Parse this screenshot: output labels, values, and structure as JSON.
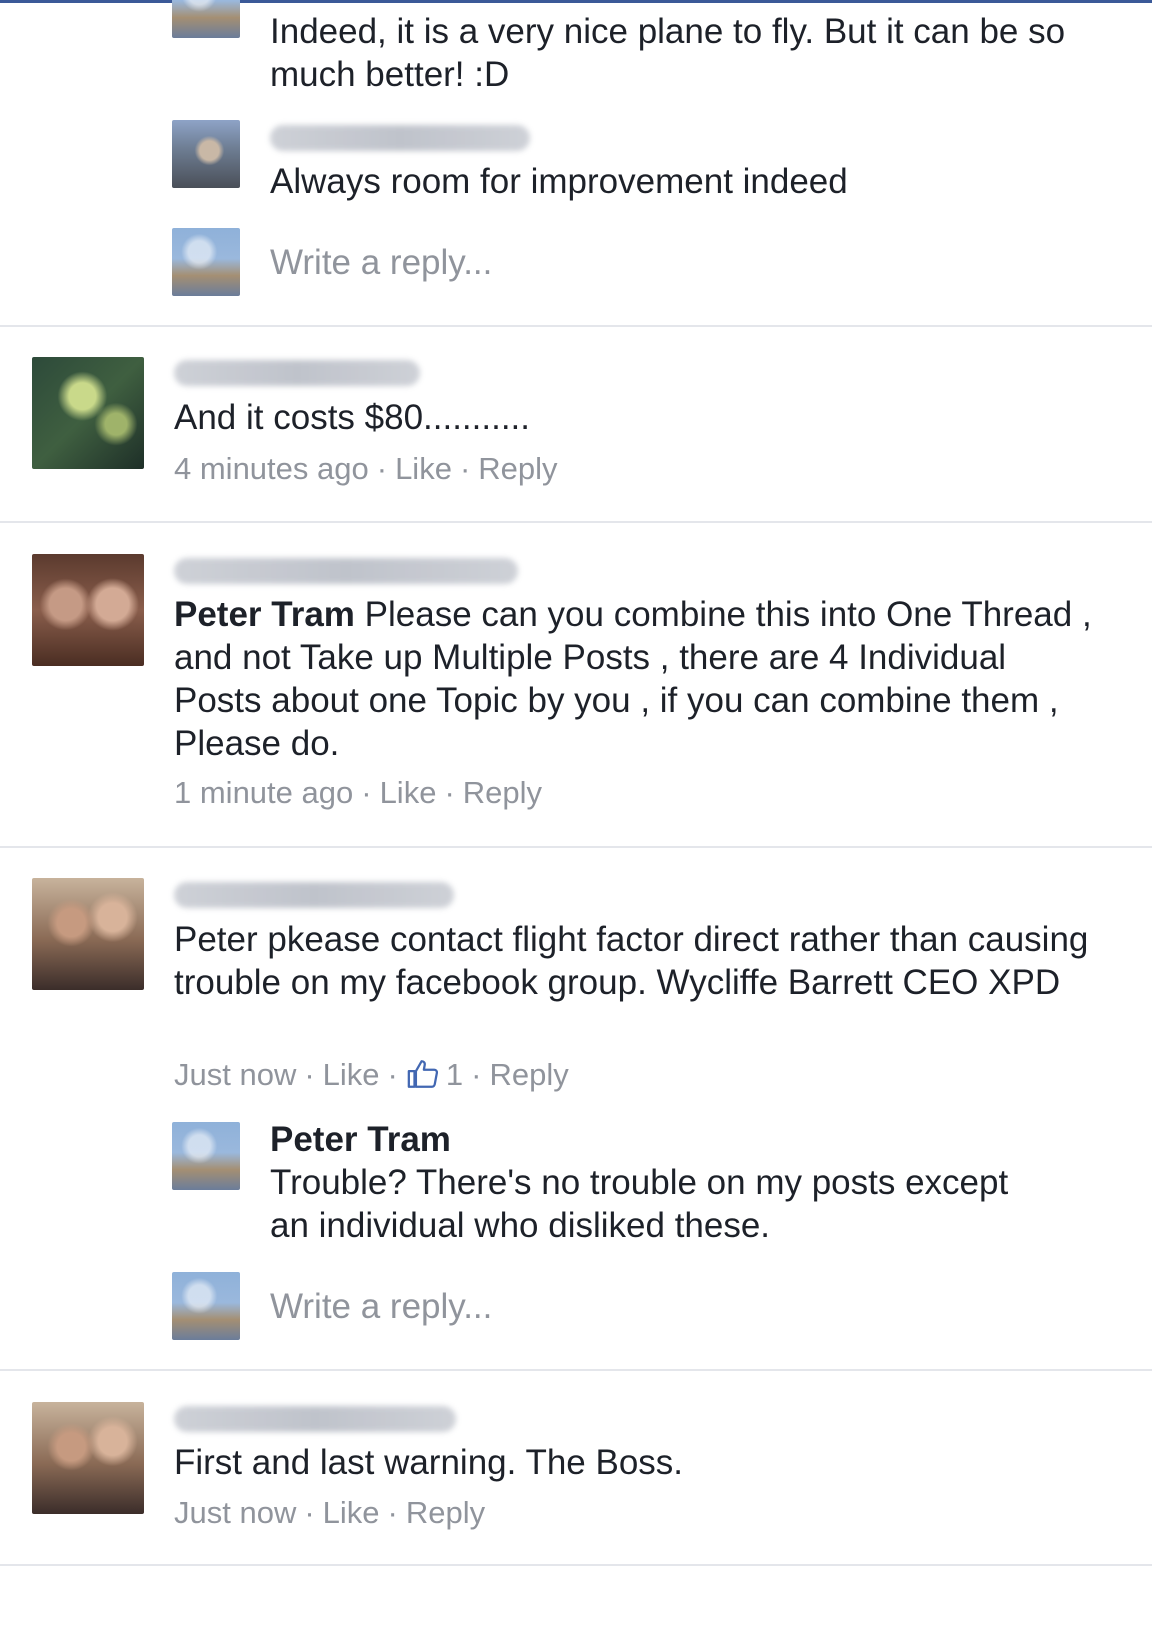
{
  "thread": {
    "top_reply_text": "Indeed, it is a very nice plane to fly. But it can be so much better! :D",
    "jake_reply_text": "Always room for improvement indeed",
    "write_reply_placeholder": "Write a reply...",
    "comments": [
      {
        "text": "And it costs $80...........",
        "time": "4 minutes ago",
        "like": "Like",
        "reply": "Reply"
      },
      {
        "mention": "Peter Tram",
        "text": " Please can you combine this into One Thread , and not Take up Multiple Posts , there are 4 Individual Posts about one Topic by you , if you can combine them , Please do.",
        "time": "1 minute ago",
        "like": "Like",
        "reply": "Reply"
      },
      {
        "text": "Peter pkease contact flight factor direct rather than causing trouble on my facebook group. Wycliffe Barrett CEO XPD",
        "time": "Just now",
        "like": "Like",
        "like_count": "1",
        "reply": "Reply"
      },
      {
        "text": "First and last warning. The Boss.",
        "time": "Just now",
        "like": "Like",
        "reply": "Reply"
      }
    ],
    "peter_reply": {
      "author": "Peter Tram",
      "text": "Trouble? There's no trouble on my posts except an individual who disliked these."
    },
    "separator": "·",
    "icons": {
      "like_thumb": "thumbs-up-icon"
    },
    "colors": {
      "text": "#1d2129",
      "meta": "#90949c",
      "divider": "#e4e6eb",
      "like_icon": "#4267b2"
    }
  }
}
